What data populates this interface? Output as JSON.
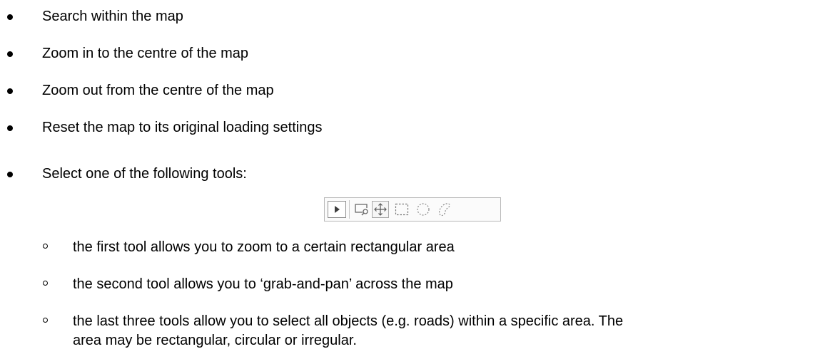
{
  "bullets": [
    "Search within the map",
    "Zoom in to the centre of the map",
    "Zoom out from the centre of the map",
    "Reset the map to its original loading settings",
    "Select one of the following tools:"
  ],
  "sub_bullets": [
    "the first tool allows you to zoom to a certain rectangular area",
    "the second tool allows you to ‘grab-and-pan’ across the map",
    "the last three tools allow you to select all objects (e.g. roads) within a specific area. The",
    "area may be rectangular, circular or irregular."
  ],
  "toolbar": {
    "tools": [
      {
        "icon": "play-icon",
        "state": "normal"
      },
      {
        "icon": "zoom-rectangle-icon",
        "state": "normal"
      },
      {
        "icon": "pan-icon",
        "state": "active"
      },
      {
        "icon": "rectangle-select-icon",
        "state": "normal"
      },
      {
        "icon": "circle-select-icon",
        "state": "normal"
      },
      {
        "icon": "lasso-select-icon",
        "state": "normal"
      }
    ]
  }
}
